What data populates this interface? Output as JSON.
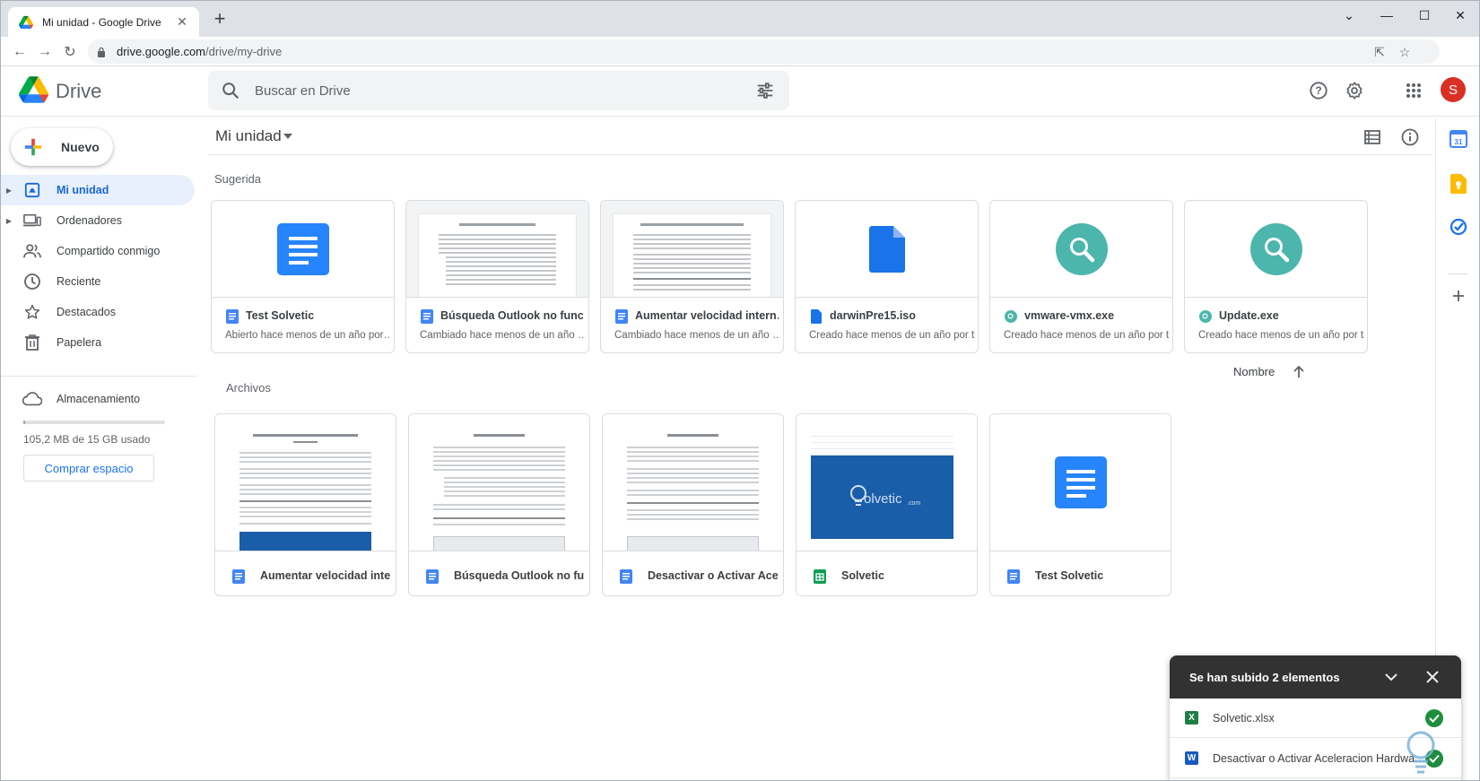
{
  "browser": {
    "tab_title": "Mi unidad - Google Drive",
    "url_domain": "drive.google.com",
    "url_path": "/drive/my-drive",
    "profile_initial": "S"
  },
  "header": {
    "app_name": "Drive",
    "search_placeholder": "Buscar en Drive",
    "avatar_initial": "S"
  },
  "sidebar": {
    "new_label": "Nuevo",
    "items": [
      {
        "label": "Mi unidad",
        "icon": "my-drive-icon",
        "active": true
      },
      {
        "label": "Ordenadores",
        "icon": "computers-icon"
      },
      {
        "label": "Compartido conmigo",
        "icon": "shared-icon"
      },
      {
        "label": "Reciente",
        "icon": "clock-icon"
      },
      {
        "label": "Destacados",
        "icon": "star-icon"
      },
      {
        "label": "Papelera",
        "icon": "trash-icon"
      }
    ],
    "storage_label": "Almacenamiento",
    "storage_used_text": "105,2 MB de 15 GB usado",
    "storage_used_fraction": 0.007,
    "buy_label": "Comprar espacio"
  },
  "main": {
    "title": "Mi unidad",
    "suggested_label": "Sugerida",
    "files_label": "Archivos",
    "sort_label": "Nombre",
    "suggested": [
      {
        "name": "Test Solvetic",
        "sub": "Abierto hace menos de un año por…",
        "icon": "docs-icon"
      },
      {
        "name": "Búsqueda Outlook no func…",
        "sub": "Cambiado hace menos de un año …",
        "icon": "docs-icon"
      },
      {
        "name": "Aumentar velocidad intern…",
        "sub": "Cambiado hace menos de un año …",
        "icon": "docs-icon"
      },
      {
        "name": "darwinPre15.iso",
        "sub": "Creado hace menos de un año por ti",
        "icon": "file-icon"
      },
      {
        "name": "vmware-vmx.exe",
        "sub": "Creado hace menos de un año por ti",
        "icon": "exe-icon"
      },
      {
        "name": "Update.exe",
        "sub": "Creado hace menos de un año por ti",
        "icon": "exe-icon"
      }
    ],
    "files": [
      {
        "name": "Aumentar velocidad inter…",
        "icon": "docs-icon"
      },
      {
        "name": "Búsqueda Outlook no fun…",
        "icon": "docs-icon"
      },
      {
        "name": "Desactivar o Activar Acel…",
        "icon": "docs-icon"
      },
      {
        "name": "Solvetic",
        "icon": "sheets-icon"
      },
      {
        "name": "Test Solvetic",
        "icon": "docs-icon"
      }
    ]
  },
  "side_panel": {
    "calendar_day": "31"
  },
  "upload": {
    "title": "Se han subido 2 elementos",
    "items": [
      {
        "name": "Solvetic.xlsx",
        "badge": "X",
        "color": "#1e7e45"
      },
      {
        "name": "Desactivar o Activar Aceleracion Hardwa…",
        "badge": "W",
        "color": "#185abd"
      }
    ]
  },
  "colors": {
    "accent": "#1a73e8",
    "active_bg": "#e8f0fe",
    "docs_blue": "#4285f4",
    "exe_teal": "#4db6ac",
    "sheets_green": "#0f9d58",
    "avatar": "#d93025"
  }
}
